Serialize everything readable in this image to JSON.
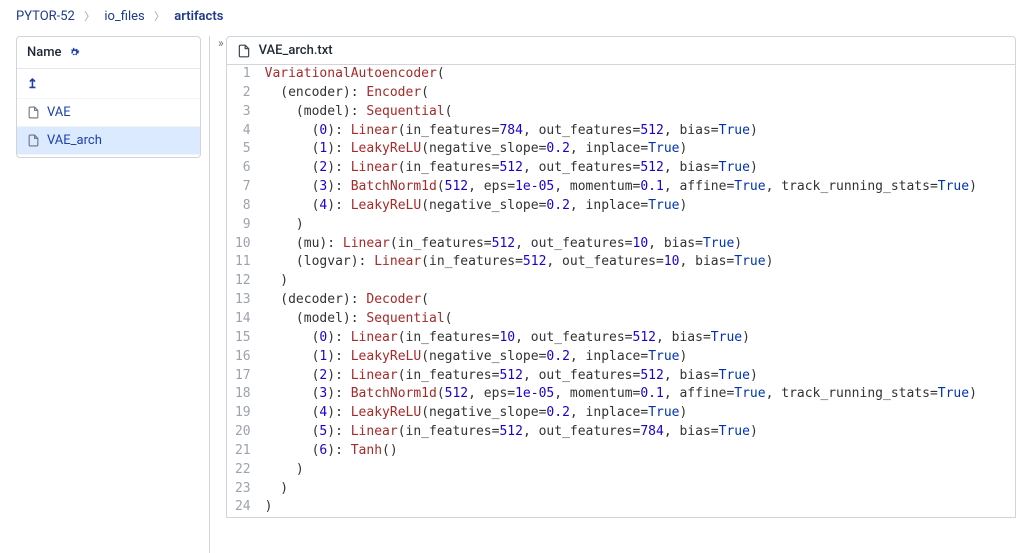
{
  "breadcrumb": {
    "items": [
      "PYTOR-52",
      "io_files",
      "artifacts"
    ]
  },
  "sidebar": {
    "header_label": "Name",
    "rows": [
      {
        "kind": "up",
        "label": ""
      },
      {
        "kind": "file",
        "label": "VAE"
      },
      {
        "kind": "file",
        "label": "VAE_arch",
        "selected": true
      }
    ]
  },
  "file": {
    "name": "VAE_arch.txt"
  },
  "code_lines": [
    [
      {
        "t": "name",
        "v": "VariationalAutoencoder"
      },
      {
        "t": "punc",
        "v": "("
      }
    ],
    [
      {
        "t": "default",
        "v": "  (encoder): "
      },
      {
        "t": "name",
        "v": "Encoder"
      },
      {
        "t": "punc",
        "v": "("
      }
    ],
    [
      {
        "t": "default",
        "v": "    (model): "
      },
      {
        "t": "name",
        "v": "Sequential"
      },
      {
        "t": "punc",
        "v": "("
      }
    ],
    [
      {
        "t": "default",
        "v": "      ("
      },
      {
        "t": "num",
        "v": "0"
      },
      {
        "t": "default",
        "v": "): "
      },
      {
        "t": "name",
        "v": "Linear"
      },
      {
        "t": "punc",
        "v": "(in_features="
      },
      {
        "t": "num",
        "v": "784"
      },
      {
        "t": "punc",
        "v": ", out_features="
      },
      {
        "t": "num",
        "v": "512"
      },
      {
        "t": "punc",
        "v": ", bias="
      },
      {
        "t": "kw",
        "v": "True"
      },
      {
        "t": "punc",
        "v": ")"
      }
    ],
    [
      {
        "t": "default",
        "v": "      ("
      },
      {
        "t": "num",
        "v": "1"
      },
      {
        "t": "default",
        "v": "): "
      },
      {
        "t": "name",
        "v": "LeakyReLU"
      },
      {
        "t": "punc",
        "v": "(negative_slope="
      },
      {
        "t": "num",
        "v": "0.2"
      },
      {
        "t": "punc",
        "v": ", inplace="
      },
      {
        "t": "kw",
        "v": "True"
      },
      {
        "t": "punc",
        "v": ")"
      }
    ],
    [
      {
        "t": "default",
        "v": "      ("
      },
      {
        "t": "num",
        "v": "2"
      },
      {
        "t": "default",
        "v": "): "
      },
      {
        "t": "name",
        "v": "Linear"
      },
      {
        "t": "punc",
        "v": "(in_features="
      },
      {
        "t": "num",
        "v": "512"
      },
      {
        "t": "punc",
        "v": ", out_features="
      },
      {
        "t": "num",
        "v": "512"
      },
      {
        "t": "punc",
        "v": ", bias="
      },
      {
        "t": "kw",
        "v": "True"
      },
      {
        "t": "punc",
        "v": ")"
      }
    ],
    [
      {
        "t": "default",
        "v": "      ("
      },
      {
        "t": "num",
        "v": "3"
      },
      {
        "t": "default",
        "v": "): "
      },
      {
        "t": "name",
        "v": "BatchNorm1d"
      },
      {
        "t": "punc",
        "v": "("
      },
      {
        "t": "num",
        "v": "512"
      },
      {
        "t": "punc",
        "v": ", eps="
      },
      {
        "t": "num",
        "v": "1e-05"
      },
      {
        "t": "punc",
        "v": ", momentum="
      },
      {
        "t": "num",
        "v": "0.1"
      },
      {
        "t": "punc",
        "v": ", affine="
      },
      {
        "t": "kw",
        "v": "True"
      },
      {
        "t": "punc",
        "v": ", track_running_stats="
      },
      {
        "t": "kw",
        "v": "True"
      },
      {
        "t": "punc",
        "v": ")"
      }
    ],
    [
      {
        "t": "default",
        "v": "      ("
      },
      {
        "t": "num",
        "v": "4"
      },
      {
        "t": "default",
        "v": "): "
      },
      {
        "t": "name",
        "v": "LeakyReLU"
      },
      {
        "t": "punc",
        "v": "(negative_slope="
      },
      {
        "t": "num",
        "v": "0.2"
      },
      {
        "t": "punc",
        "v": ", inplace="
      },
      {
        "t": "kw",
        "v": "True"
      },
      {
        "t": "punc",
        "v": ")"
      }
    ],
    [
      {
        "t": "default",
        "v": "    )"
      }
    ],
    [
      {
        "t": "default",
        "v": "    (mu): "
      },
      {
        "t": "name",
        "v": "Linear"
      },
      {
        "t": "punc",
        "v": "(in_features="
      },
      {
        "t": "num",
        "v": "512"
      },
      {
        "t": "punc",
        "v": ", out_features="
      },
      {
        "t": "num",
        "v": "10"
      },
      {
        "t": "punc",
        "v": ", bias="
      },
      {
        "t": "kw",
        "v": "True"
      },
      {
        "t": "punc",
        "v": ")"
      }
    ],
    [
      {
        "t": "default",
        "v": "    (logvar): "
      },
      {
        "t": "name",
        "v": "Linear"
      },
      {
        "t": "punc",
        "v": "(in_features="
      },
      {
        "t": "num",
        "v": "512"
      },
      {
        "t": "punc",
        "v": ", out_features="
      },
      {
        "t": "num",
        "v": "10"
      },
      {
        "t": "punc",
        "v": ", bias="
      },
      {
        "t": "kw",
        "v": "True"
      },
      {
        "t": "punc",
        "v": ")"
      }
    ],
    [
      {
        "t": "default",
        "v": "  )"
      }
    ],
    [
      {
        "t": "default",
        "v": "  (decoder): "
      },
      {
        "t": "name",
        "v": "Decoder"
      },
      {
        "t": "punc",
        "v": "("
      }
    ],
    [
      {
        "t": "default",
        "v": "    (model): "
      },
      {
        "t": "name",
        "v": "Sequential"
      },
      {
        "t": "punc",
        "v": "("
      }
    ],
    [
      {
        "t": "default",
        "v": "      ("
      },
      {
        "t": "num",
        "v": "0"
      },
      {
        "t": "default",
        "v": "): "
      },
      {
        "t": "name",
        "v": "Linear"
      },
      {
        "t": "punc",
        "v": "(in_features="
      },
      {
        "t": "num",
        "v": "10"
      },
      {
        "t": "punc",
        "v": ", out_features="
      },
      {
        "t": "num",
        "v": "512"
      },
      {
        "t": "punc",
        "v": ", bias="
      },
      {
        "t": "kw",
        "v": "True"
      },
      {
        "t": "punc",
        "v": ")"
      }
    ],
    [
      {
        "t": "default",
        "v": "      ("
      },
      {
        "t": "num",
        "v": "1"
      },
      {
        "t": "default",
        "v": "): "
      },
      {
        "t": "name",
        "v": "LeakyReLU"
      },
      {
        "t": "punc",
        "v": "(negative_slope="
      },
      {
        "t": "num",
        "v": "0.2"
      },
      {
        "t": "punc",
        "v": ", inplace="
      },
      {
        "t": "kw",
        "v": "True"
      },
      {
        "t": "punc",
        "v": ")"
      }
    ],
    [
      {
        "t": "default",
        "v": "      ("
      },
      {
        "t": "num",
        "v": "2"
      },
      {
        "t": "default",
        "v": "): "
      },
      {
        "t": "name",
        "v": "Linear"
      },
      {
        "t": "punc",
        "v": "(in_features="
      },
      {
        "t": "num",
        "v": "512"
      },
      {
        "t": "punc",
        "v": ", out_features="
      },
      {
        "t": "num",
        "v": "512"
      },
      {
        "t": "punc",
        "v": ", bias="
      },
      {
        "t": "kw",
        "v": "True"
      },
      {
        "t": "punc",
        "v": ")"
      }
    ],
    [
      {
        "t": "default",
        "v": "      ("
      },
      {
        "t": "num",
        "v": "3"
      },
      {
        "t": "default",
        "v": "): "
      },
      {
        "t": "name",
        "v": "BatchNorm1d"
      },
      {
        "t": "punc",
        "v": "("
      },
      {
        "t": "num",
        "v": "512"
      },
      {
        "t": "punc",
        "v": ", eps="
      },
      {
        "t": "num",
        "v": "1e-05"
      },
      {
        "t": "punc",
        "v": ", momentum="
      },
      {
        "t": "num",
        "v": "0.1"
      },
      {
        "t": "punc",
        "v": ", affine="
      },
      {
        "t": "kw",
        "v": "True"
      },
      {
        "t": "punc",
        "v": ", track_running_stats="
      },
      {
        "t": "kw",
        "v": "True"
      },
      {
        "t": "punc",
        "v": ")"
      }
    ],
    [
      {
        "t": "default",
        "v": "      ("
      },
      {
        "t": "num",
        "v": "4"
      },
      {
        "t": "default",
        "v": "): "
      },
      {
        "t": "name",
        "v": "LeakyReLU"
      },
      {
        "t": "punc",
        "v": "(negative_slope="
      },
      {
        "t": "num",
        "v": "0.2"
      },
      {
        "t": "punc",
        "v": ", inplace="
      },
      {
        "t": "kw",
        "v": "True"
      },
      {
        "t": "punc",
        "v": ")"
      }
    ],
    [
      {
        "t": "default",
        "v": "      ("
      },
      {
        "t": "num",
        "v": "5"
      },
      {
        "t": "default",
        "v": "): "
      },
      {
        "t": "name",
        "v": "Linear"
      },
      {
        "t": "punc",
        "v": "(in_features="
      },
      {
        "t": "num",
        "v": "512"
      },
      {
        "t": "punc",
        "v": ", out_features="
      },
      {
        "t": "num",
        "v": "784"
      },
      {
        "t": "punc",
        "v": ", bias="
      },
      {
        "t": "kw",
        "v": "True"
      },
      {
        "t": "punc",
        "v": ")"
      }
    ],
    [
      {
        "t": "default",
        "v": "      ("
      },
      {
        "t": "num",
        "v": "6"
      },
      {
        "t": "default",
        "v": "): "
      },
      {
        "t": "name",
        "v": "Tanh"
      },
      {
        "t": "punc",
        "v": "()"
      }
    ],
    [
      {
        "t": "default",
        "v": "    )"
      }
    ],
    [
      {
        "t": "default",
        "v": "  )"
      }
    ],
    [
      {
        "t": "default",
        "v": ")"
      }
    ]
  ]
}
